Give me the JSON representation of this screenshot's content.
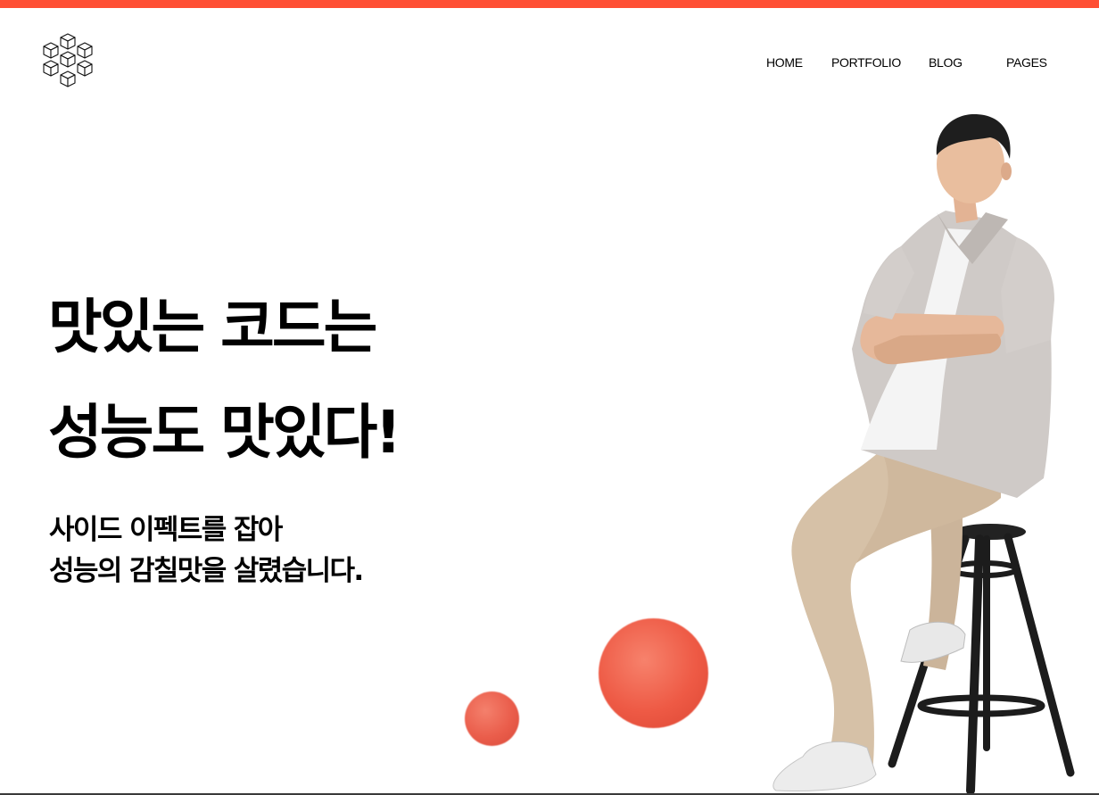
{
  "colors": {
    "accent": "#ff4f34",
    "ball": "#ee5a45",
    "text": "#000000"
  },
  "header": {
    "logo_icon": "cubes-icon"
  },
  "nav": {
    "items": [
      {
        "label": "HOME"
      },
      {
        "label": "PORTFOLIO"
      },
      {
        "label": "BLOG"
      },
      {
        "label": "PAGES"
      }
    ]
  },
  "hero": {
    "title_line_1": "맛있는 코드는",
    "title_line_2": "성능도 맛있다!",
    "subtitle_line_1": "사이드 이펙트를 잡아",
    "subtitle_line_2": "성능의 감칠맛을 살렸습니다."
  },
  "decor": {
    "balls": [
      "red-sphere-small",
      "red-sphere-large"
    ],
    "figure": "person-sitting-on-stool"
  }
}
